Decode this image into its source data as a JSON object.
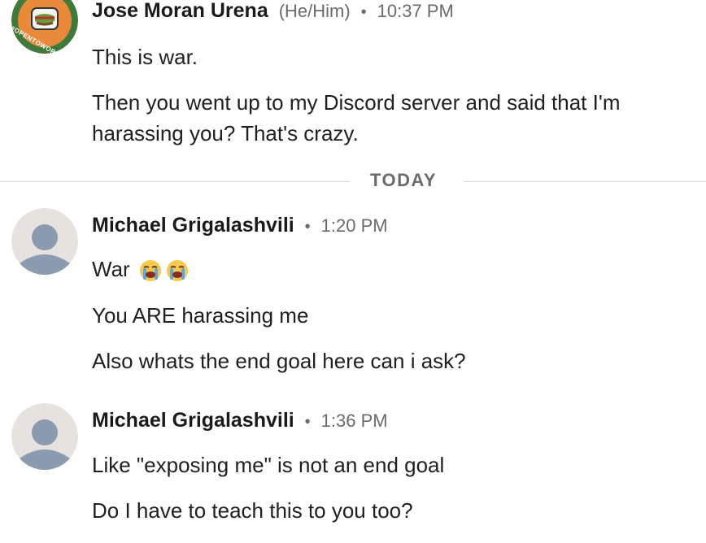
{
  "messages": [
    {
      "author": "Jose Moran Urena",
      "pronouns": "(He/Him)",
      "separator": "•",
      "time": "10:37 PM",
      "avatar_badge": "#OPENTOWORK",
      "lines": [
        "This is war.",
        "Then you went up to my Discord server and said that I'm",
        "harassing you? That's crazy."
      ]
    },
    {
      "author": "Michael Grigalashvili",
      "separator": "•",
      "time": "1:20 PM",
      "lines": [
        "War",
        "You ARE harassing me",
        "Also whats the end goal here can i ask?"
      ],
      "emoji": [
        "loudly-crying-face-icon",
        "loudly-crying-face-icon"
      ]
    },
    {
      "author": "Michael Grigalashvili",
      "separator": "•",
      "time": "1:36 PM",
      "lines": [
        "Like \"exposing me\" is not an end goal",
        "Do I have to teach this to you too?"
      ]
    }
  ],
  "divider": {
    "label": "TODAY"
  },
  "colors": {
    "text": "#1f1f1f",
    "meta": "#6b6b6b",
    "opentowork_green": "#3f7a3b",
    "avatar_orange": "#e9893a",
    "default_avatar_bg": "#e6e3de",
    "default_avatar_figure": "#8b9bb0"
  }
}
